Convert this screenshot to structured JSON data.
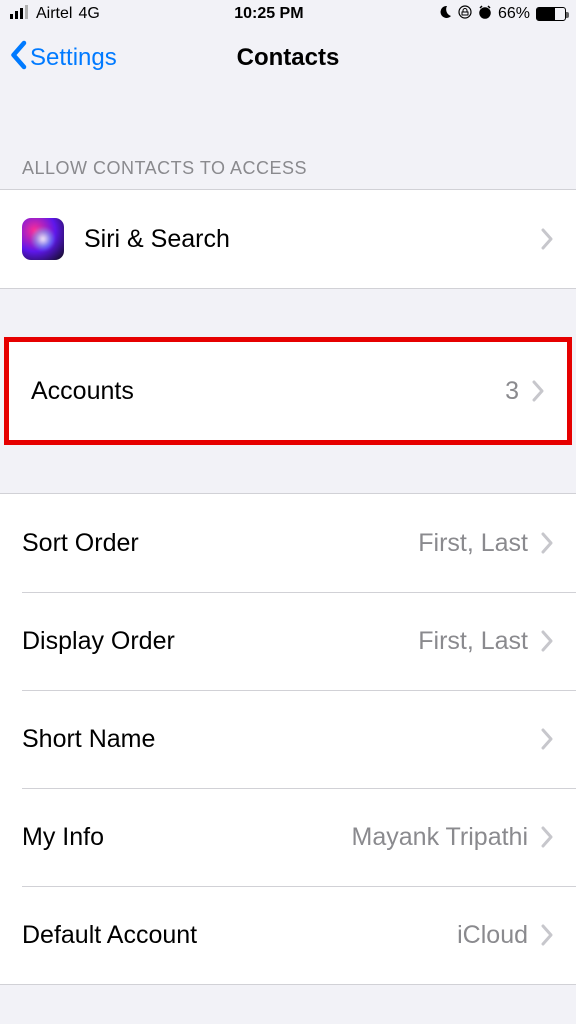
{
  "status": {
    "carrier": "Airtel",
    "network": "4G",
    "time": "10:25 PM",
    "battery_pct": "66%",
    "battery_fill_pct": 66
  },
  "nav": {
    "back_label": "Settings",
    "title": "Contacts"
  },
  "section1": {
    "header": "ALLOW CONTACTS TO ACCESS",
    "siri_label": "Siri & Search"
  },
  "section2": {
    "accounts_label": "Accounts",
    "accounts_count": "3"
  },
  "section3": {
    "sort_label": "Sort Order",
    "sort_value": "First, Last",
    "display_label": "Display Order",
    "display_value": "First, Last",
    "short_name_label": "Short Name",
    "myinfo_label": "My Info",
    "myinfo_value": "Mayank Tripathi",
    "default_label": "Default Account",
    "default_value": "iCloud"
  }
}
